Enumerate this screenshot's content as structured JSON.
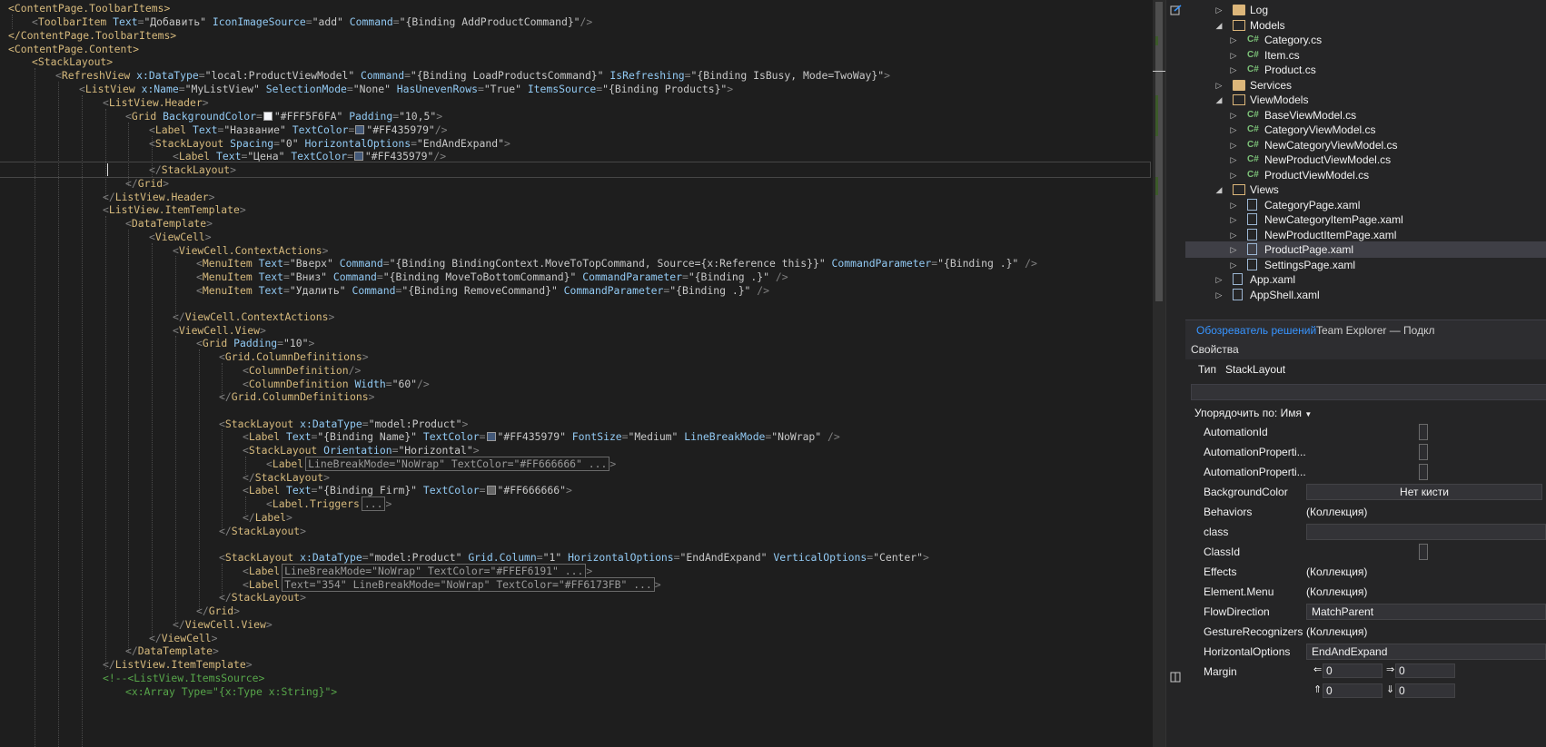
{
  "editor": {
    "lines": [
      {
        "indent": 0,
        "html_key": "l0"
      },
      {
        "indent": 1,
        "html_key": "l1"
      }
    ],
    "code": {
      "l0": "<ContentPage.ToolbarItems>",
      "l1_a": "<ToolbarItem ",
      "l1_text_attr": "Text",
      "l1_text_val": "\"Добавить\"",
      "l1_icon_attr": "IconImageSource",
      "l1_icon_val": "\"add\"",
      "l1_cmd_attr": "Command",
      "l1_cmd_val": "\"{Binding AddProductCommand}\"",
      "l2": "</ContentPage.ToolbarItems>",
      "l3": "<ContentPage.Content>",
      "l4": "<StackLayout>",
      "l5_tag": "RefreshView",
      "l5_a1": "x:DataType",
      "l5_v1": "\"local:ProductViewModel\"",
      "l5_a2": "Command",
      "l5_v2": "\"{Binding LoadProductsCommand}\"",
      "l5_a3": "IsRefreshing",
      "l5_v3": "\"{Binding IsBusy, Mode=TwoWay}\"",
      "l6_tag": "ListView",
      "l6_a1": "x:Name",
      "l6_v1": "\"MyListView\"",
      "l6_a2": "SelectionMode",
      "l6_v2": "\"None\"",
      "l6_a3": "HasUnevenRows",
      "l6_v3": "\"True\"",
      "l6_a4": "ItemsSource",
      "l6_v4": "\"{Binding Products}\"",
      "l7": "ListView.Header",
      "l8_tag": "Grid",
      "l8_a1": "BackgroundColor",
      "l8_v1": "\"#FFF5F6FA\"",
      "l8_a2": "Padding",
      "l8_v2": "\"10,5\"",
      "l9_tag": "Label",
      "l9_a1": "Text",
      "l9_v1": "\"Название\"",
      "l9_a2": "TextColor",
      "l9_v2": "\"#FF435979\"",
      "l10_tag": "StackLayout",
      "l10_a1": "Spacing",
      "l10_v1": "\"0\"",
      "l10_a2": "HorizontalOptions",
      "l10_v2": "\"EndAndExpand\"",
      "l11_tag": "Label",
      "l11_a1": "Text",
      "l11_v1": "\"Цена\"",
      "l11_a2": "TextColor",
      "l11_v2": "\"#FF435979\"",
      "l12": "StackLayout",
      "l13": "Grid",
      "l14": "ListView.Header",
      "l15": "ListView.ItemTemplate",
      "l16": "DataTemplate",
      "l17": "ViewCell",
      "l18": "ViewCell.ContextActions",
      "l19_tag": "MenuItem",
      "l19_a1": "Text",
      "l19_v1": "\"Вверх\"",
      "l19_a2": "Command",
      "l19_v2": "\"{Binding BindingContext.MoveToTopCommand, Source={x:Reference this}}\"",
      "l19_a3": "CommandParameter",
      "l19_v3": "\"{Binding .}\"",
      "l20_tag": "MenuItem",
      "l20_a1": "Text",
      "l20_v1": "\"Вниз\"",
      "l20_a2": "Command",
      "l20_v2": "\"{Binding MoveToBottomCommand}\"",
      "l20_a3": "CommandParameter",
      "l20_v3": "\"{Binding .}\"",
      "l21_tag": "MenuItem",
      "l21_a1": "Text",
      "l21_v1": "\"Удалить\"",
      "l21_a2": "Command",
      "l21_v2": "\"{Binding RemoveCommand}\"",
      "l21_a3": "CommandParameter",
      "l21_v3": "\"{Binding .}\"",
      "l23": "ViewCell.ContextActions",
      "l24": "ViewCell.View",
      "l25_tag": "Grid",
      "l25_a1": "Padding",
      "l25_v1": "\"10\"",
      "l26": "Grid.ColumnDefinitions",
      "l27": "ColumnDefinition",
      "l28_tag": "ColumnDefinition",
      "l28_a1": "Width",
      "l28_v1": "\"60\"",
      "l29": "Grid.ColumnDefinitions",
      "l31_tag": "StackLayout",
      "l31_a1": "x:DataType",
      "l31_v1": "\"model:Product\"",
      "l32_tag": "Label",
      "l32_a1": "Text",
      "l32_v1": "\"{Binding Name}\"",
      "l32_a2": "TextColor",
      "l32_v2": "\"#FF435979\"",
      "l32_a3": "FontSize",
      "l32_v3": "\"Medium\"",
      "l32_a4": "LineBreakMode",
      "l32_v4": "\"NoWrap\"",
      "l33_tag": "StackLayout",
      "l33_a1": "Orientation",
      "l33_v1": "\"Horizontal\"",
      "l34_tag": "Label",
      "l34_collapsed": "LineBreakMode=\"NoWrap\" TextColor=\"#FF666666\" ...",
      "l35": "StackLayout",
      "l36_tag": "Label",
      "l36_a1": "Text",
      "l36_v1": "\"{Binding Firm}\"",
      "l36_a2": "TextColor",
      "l36_v2": "\"#FF666666\"",
      "l37_tag": "Label.Triggers",
      "l37_collapsed": "...",
      "l38": "Label",
      "l39": "StackLayout",
      "l41_tag": "StackLayout",
      "l41_a1": "x:DataType",
      "l41_v1": "\"model:Product\"",
      "l41_a2": "Grid.Column",
      "l41_v2": "\"1\"",
      "l41_a3": "HorizontalOptions",
      "l41_v3": "\"EndAndExpand\"",
      "l41_a4": "VerticalOptions",
      "l41_v4": "\"Center\"",
      "l42_tag": "Label",
      "l42_collapsed": "LineBreakMode=\"NoWrap\" TextColor=\"#FFEF6191\" ...",
      "l43_tag": "Label",
      "l43_collapsed": "Text=\"354\" LineBreakMode=\"NoWrap\" TextColor=\"#FF6173FB\" ...",
      "l44": "StackLayout",
      "l45": "Grid",
      "l46": "ViewCell.View",
      "l47": "ViewCell",
      "l48": "DataTemplate",
      "l49": "ListView.ItemTemplate",
      "l50": "<!--<ListView.ItemsSource>",
      "l51": "<x:Array Type=\"{x:Type x:String}\">"
    },
    "swatch_colors": {
      "f5f6fa": "#f5f6fa",
      "435979": "#435979",
      "666666": "#666666"
    }
  },
  "solution_explorer": {
    "items": [
      {
        "label": "Log",
        "type": "folder",
        "expanded": false
      },
      {
        "label": "Models",
        "type": "folder",
        "expanded": true
      },
      {
        "label": "Category.cs",
        "type": "cs"
      },
      {
        "label": "Item.cs",
        "type": "cs"
      },
      {
        "label": "Product.cs",
        "type": "cs"
      },
      {
        "label": "Services",
        "type": "folder",
        "expanded": false
      },
      {
        "label": "ViewModels",
        "type": "folder",
        "expanded": true
      },
      {
        "label": "BaseViewModel.cs",
        "type": "cs"
      },
      {
        "label": "CategoryViewModel.cs",
        "type": "cs"
      },
      {
        "label": "NewCategoryViewModel.cs",
        "type": "cs"
      },
      {
        "label": "NewProductViewModel.cs",
        "type": "cs"
      },
      {
        "label": "ProductViewModel.cs",
        "type": "cs"
      },
      {
        "label": "Views",
        "type": "folder",
        "expanded": true
      },
      {
        "label": "CategoryPage.xaml",
        "type": "xaml"
      },
      {
        "label": "NewCategoryItemPage.xaml",
        "type": "xaml"
      },
      {
        "label": "NewProductItemPage.xaml",
        "type": "xaml"
      },
      {
        "label": "ProductPage.xaml",
        "type": "xaml",
        "selected": true
      },
      {
        "label": "SettingsPage.xaml",
        "type": "xaml"
      },
      {
        "label": "App.xaml",
        "type": "xaml"
      },
      {
        "label": "AppShell.xaml",
        "type": "xaml"
      }
    ],
    "cs_glyph": "C#"
  },
  "tabs": {
    "solution": "Обозреватель решений",
    "team": "Team Explorer — Подкл"
  },
  "properties": {
    "header": "Свойства",
    "type_label": "Тип",
    "type_value": "StackLayout",
    "sort_label": "Упорядочить по: Имя",
    "rows": [
      {
        "name": "AutomationId",
        "value": "",
        "kind": "box"
      },
      {
        "name": "AutomationProperti...",
        "value": "",
        "kind": "box"
      },
      {
        "name": "AutomationProperti...",
        "value": "",
        "kind": "box"
      },
      {
        "name": "BackgroundColor",
        "value": "Нет кисти",
        "kind": "center"
      },
      {
        "name": "Behaviors",
        "value": "(Коллекция)",
        "kind": "text"
      },
      {
        "name": "class",
        "value": "",
        "kind": "box"
      },
      {
        "name": "ClassId",
        "value": "",
        "kind": "box"
      },
      {
        "name": "Effects",
        "value": "(Коллекция)",
        "kind": "text"
      },
      {
        "name": "Element.Menu",
        "value": "(Коллекция)",
        "kind": "text"
      },
      {
        "name": "FlowDirection",
        "value": "MatchParent",
        "kind": "box"
      },
      {
        "name": "GestureRecognizers",
        "value": "(Коллекция)",
        "kind": "text"
      },
      {
        "name": "HorizontalOptions",
        "value": "EndAndExpand",
        "kind": "box"
      },
      {
        "name": "Margin",
        "value": "",
        "kind": "margin"
      }
    ],
    "margin": {
      "left": "0",
      "right": "0",
      "top": "0",
      "bottom": "0"
    }
  }
}
